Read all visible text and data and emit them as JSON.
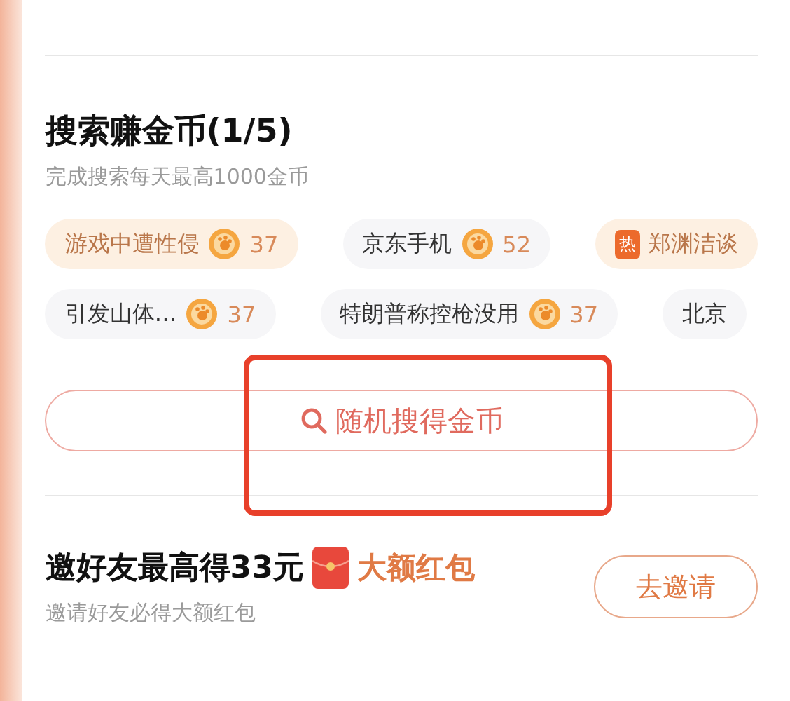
{
  "search_task": {
    "title": "搜索赚金币(1/5)",
    "subtitle": "完成搜索每天最高1000金币",
    "tag_rows": [
      [
        {
          "label": "游戏中遭性侵",
          "coins": "37",
          "highlighted": true
        },
        {
          "label": "京东手机",
          "coins": "52",
          "highlighted": false
        },
        {
          "label": "郑渊洁谈",
          "badge": "热",
          "highlighted": true
        }
      ],
      [
        {
          "label": "引发山体…",
          "coins": "37",
          "highlighted": false
        },
        {
          "label": "特朗普称控枪没用",
          "coins": "37",
          "highlighted": false
        },
        {
          "label": "北京",
          "highlighted": false
        }
      ]
    ],
    "random_button": "随机搜得金币"
  },
  "invite_task": {
    "title": "邀好友最高得33元",
    "tag": "大额红包",
    "subtitle": "邀请好友必得大额红包",
    "button": "去邀请"
  }
}
